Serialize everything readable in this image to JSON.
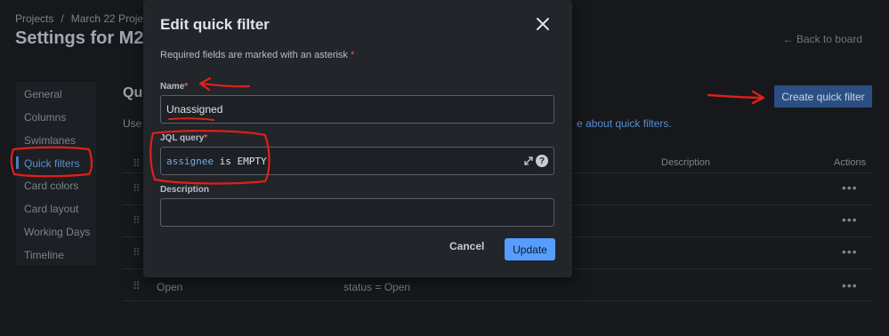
{
  "breadcrumb": {
    "items": [
      "Projects",
      "March 22 Project"
    ]
  },
  "page": {
    "title": "Settings for M2P",
    "back_link": "← Back to board"
  },
  "sidebar": {
    "items": [
      {
        "label": "General"
      },
      {
        "label": "Columns"
      },
      {
        "label": "Swimlanes"
      },
      {
        "label": "Quick filters",
        "active": true
      },
      {
        "label": "Card colors"
      },
      {
        "label": "Card layout"
      },
      {
        "label": "Working Days"
      },
      {
        "label": "Timeline"
      }
    ]
  },
  "main": {
    "section_title": "Qu",
    "intro_text": "Use",
    "intro_link": "e about quick filters.",
    "create_button": "Create quick filter",
    "table": {
      "headers": {
        "description": "Description",
        "actions": "Actions"
      },
      "rows": [
        {
          "name": "",
          "query": ""
        },
        {
          "name": "",
          "query": ""
        },
        {
          "name": "",
          "query": ""
        },
        {
          "name": "Open",
          "query": "status = Open"
        }
      ]
    }
  },
  "modal": {
    "title": "Edit quick filter",
    "required_note": "Required fields are marked with an asterisk",
    "name_label": "Name",
    "name_value": "Unassigned",
    "jql_label": "JQL query",
    "jql_tokens": {
      "field": "assignee",
      "operator": "is",
      "value": "EMPTY"
    },
    "description_label": "Description",
    "description_value": "",
    "asterisk": "*",
    "help_glyph": "?",
    "cancel_label": "Cancel",
    "update_label": "Update"
  },
  "icons": {
    "close": "close-icon",
    "expand": "expand-icon",
    "help": "help-icon",
    "drag": "drag-handle-icon",
    "more": "more-actions-icon"
  },
  "colors": {
    "accent": "#579dff",
    "asterisk": "#ef5c48",
    "annotation": "#e0201a",
    "modal_bg": "#22252a",
    "page_bg": "#16181b"
  }
}
